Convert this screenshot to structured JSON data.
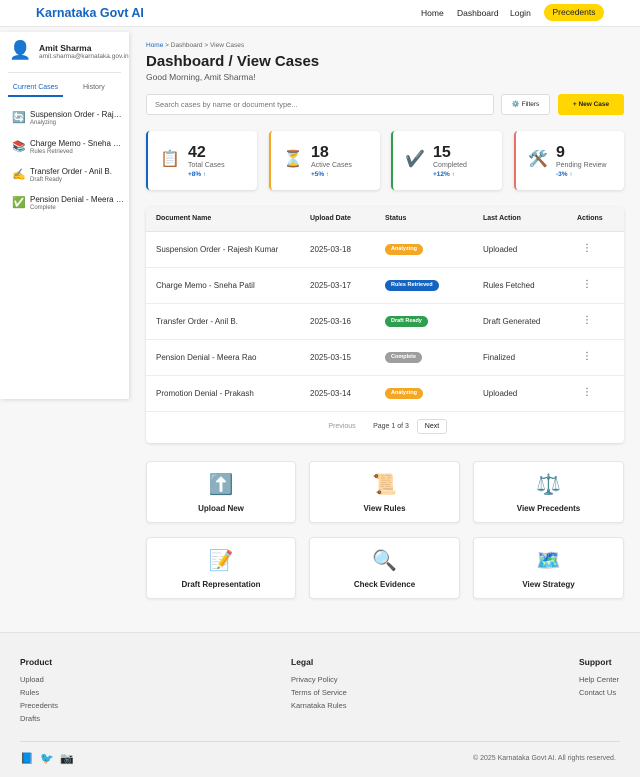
{
  "header": {
    "brand": "Karnataka Govt AI",
    "nav": [
      "Home",
      "Dashboard",
      "Login"
    ],
    "cta": "Precedents"
  },
  "sidebar": {
    "user_name": "Amit Sharma",
    "user_email": "amit.sharma@karnataka.gov.in",
    "tabs": [
      "Current Cases",
      "History"
    ],
    "cases": [
      {
        "icon": "🔄",
        "title": "Suspension Order - Rajesh Kumar",
        "status": "Analyzing"
      },
      {
        "icon": "📚",
        "title": "Charge Memo - Sneha Patil",
        "status": "Rules Retrieved"
      },
      {
        "icon": "✍️",
        "title": "Transfer Order - Anil B.",
        "status": "Draft Ready"
      },
      {
        "icon": "✅",
        "title": "Pension Denial - Meera Rao",
        "status": "Complete"
      }
    ]
  },
  "main": {
    "breadcrumb": {
      "home": "Home",
      "rest": " > Dashboard > View Cases"
    },
    "title": "Dashboard / View Cases",
    "greeting": "Good Morning, Amit Sharma!",
    "search_placeholder": "Search cases by name or document type...",
    "filters_label": "⚙️ Filters",
    "new_case_label": "+ New Case"
  },
  "stats": [
    {
      "icon": "📋",
      "value": "42",
      "label": "Total Cases",
      "change": "+8% ↑",
      "color": "#1565c0"
    },
    {
      "icon": "⏳",
      "value": "18",
      "label": "Active Cases",
      "change": "+5% ↑",
      "color": "#f5a623"
    },
    {
      "icon": "✔️",
      "value": "15",
      "label": "Completed",
      "change": "+12% ↑",
      "color": "#2e9e4f"
    },
    {
      "icon": "🛠️",
      "value": "9",
      "label": "Pending Review",
      "change": "-3% ↑",
      "color": "#e57368"
    }
  ],
  "table": {
    "columns": [
      "Document Name",
      "Upload Date",
      "Status",
      "Last Action",
      "Actions"
    ],
    "rows": [
      {
        "name": "Suspension Order - Rajesh Kumar",
        "date": "2025-03-18",
        "status": "Analyzing",
        "status_color": "#f5a623",
        "action": "Uploaded"
      },
      {
        "name": "Charge Memo - Sneha Patil",
        "date": "2025-03-17",
        "status": "Rules Retrieved",
        "status_color": "#1565c0",
        "action": "Rules Fetched"
      },
      {
        "name": "Transfer Order - Anil B.",
        "date": "2025-03-16",
        "status": "Draft Ready",
        "status_color": "#2e9e4f",
        "action": "Draft Generated"
      },
      {
        "name": "Pension Denial - Meera Rao",
        "date": "2025-03-15",
        "status": "Complete",
        "status_color": "#9e9e9e",
        "action": "Finalized"
      },
      {
        "name": "Promotion Denial - Prakash",
        "date": "2025-03-14",
        "status": "Analyzing",
        "status_color": "#f5a623",
        "action": "Uploaded"
      }
    ],
    "kebab": "⋮",
    "pagination": {
      "prev": "Previous",
      "info": "Page 1 of 3",
      "next": "Next"
    }
  },
  "actions": [
    {
      "icon": "⬆️",
      "label": "Upload New"
    },
    {
      "icon": "📜",
      "label": "View Rules"
    },
    {
      "icon": "⚖️",
      "label": "View Precedents"
    },
    {
      "icon": "📝",
      "label": "Draft Representation"
    },
    {
      "icon": "🔍",
      "label": "Check Evidence"
    },
    {
      "icon": "🗺️",
      "label": "View Strategy"
    }
  ],
  "footer": {
    "product": {
      "title": "Product",
      "links": [
        "Upload",
        "Rules",
        "Precedents",
        "Drafts"
      ]
    },
    "legal": {
      "title": "Legal",
      "links": [
        "Privacy Policy",
        "Terms of Service",
        "Karnataka Rules"
      ]
    },
    "support": {
      "title": "Support",
      "links": [
        "Help Center",
        "Contact Us"
      ]
    },
    "social": [
      "📘",
      "🐦",
      "📷"
    ],
    "copyright": "© 2025 Karnataka Govt AI. All rights reserved."
  }
}
